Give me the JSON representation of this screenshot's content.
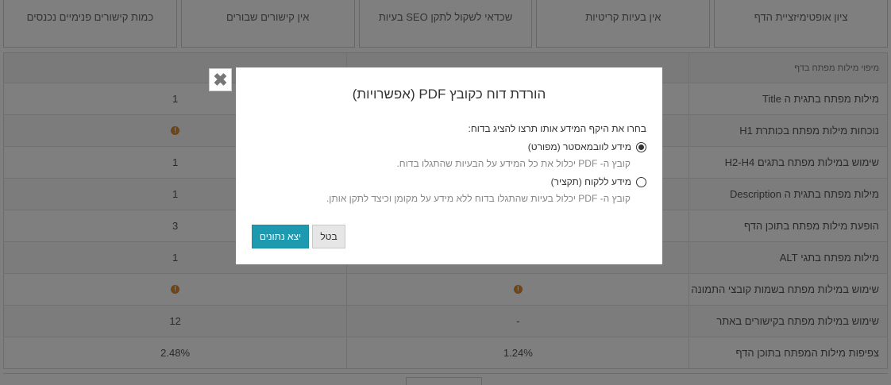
{
  "cards": [
    {
      "label": "ציון אופטימיזציית הדף",
      "value": ""
    },
    {
      "label": "אין בעיות קריטיות",
      "value": ""
    },
    {
      "label": "בעיות SEO שכדאי לשקול לתקן",
      "value": ""
    },
    {
      "label": "אין קישורים שבורים",
      "value": ""
    },
    {
      "label": "כמות קישורים פנימיים נכנסים",
      "value": ""
    }
  ],
  "table": {
    "headers": [
      "מיפוי מילות מפתח בדף",
      "",
      ""
    ],
    "rows": [
      {
        "name": "מילות מפתח בתגית ה Title",
        "c2": "",
        "c3": "1"
      },
      {
        "name": "נוכחות מילות מפתח בכותרת H1",
        "c2": "",
        "c3": "!"
      },
      {
        "name": "שימוש במילות מפתח בתגים H2-H4",
        "c2": "",
        "c3": "1"
      },
      {
        "name": "מילות מפתח בתגית ה Description",
        "c2": "",
        "c3": "1"
      },
      {
        "name": "הופעת מילות מפתח בתוכן הדף",
        "c2": "",
        "c3": "3"
      },
      {
        "name": "מילות מפתח בתגי ALT",
        "c2": "",
        "c3": "1"
      },
      {
        "name": "שימוש במילות מפתח בשמות קובצי התמונה",
        "c2": "!",
        "c3": "!"
      },
      {
        "name": "שימוש במילות מפתח בקישורים באתר",
        "c2": "-",
        "c3": "12"
      },
      {
        "name": "צפיפות מילות המפתח בתוכן הדף",
        "c2": "1.24%",
        "c3": "2.48%"
      }
    ]
  },
  "modal": {
    "title": "הורדת דוח כקובץ PDF (אפשרויות)",
    "question": "בחרו את היקף המידע אותו תרצו להציג בדוח:",
    "options": [
      {
        "label": "מידע לוובמאסטר (מפורט)",
        "description": "קובץ ה- PDF יכלול את כל המידע על הבעיות שהתגלו בדוח.",
        "checked": true
      },
      {
        "label": "מידע ללקוח (תקציר)",
        "description": "קובץ ה- PDF יכלול בעיות שהתגלו בדוח ללא מידע על מקומן וכיצד לתקן אותן.",
        "checked": false
      }
    ],
    "export_label": "יצא נתונים",
    "cancel_label": "בטל",
    "close_glyph": "✖"
  },
  "colors": {
    "accent": "#1e9ab0",
    "warning": "#e08a2c",
    "overlay": "rgba(0,0,0,0.5)"
  }
}
